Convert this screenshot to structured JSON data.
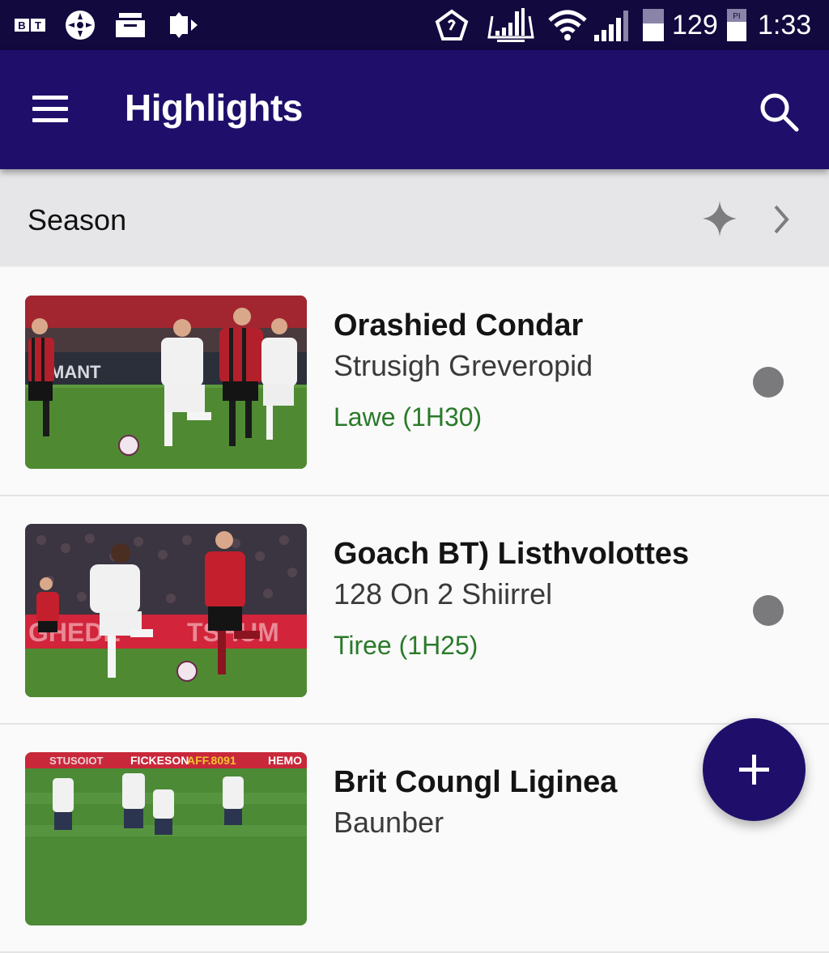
{
  "status_bar": {
    "left_icons": [
      "bt-sport-icon",
      "football-icon",
      "tray-icon",
      "cast-icon"
    ],
    "left_icon_text": "BT",
    "right_icons": [
      "pentagon-notification-icon",
      "chart-notification-icon",
      "wifi-icon",
      "signal-icon"
    ],
    "battery_value": "129",
    "battery_label": "PI",
    "time": "1:33"
  },
  "app_bar": {
    "title": "Highlights",
    "menu_icon": "hamburger-menu-icon",
    "search_icon": "search-icon",
    "color": "#1f0f6b"
  },
  "season_bar": {
    "label": "Season",
    "star_icon": "sparkle-icon",
    "chevron_icon": "chevron-right-icon"
  },
  "items": [
    {
      "title": "Orashied Condar",
      "subtitle": "Strusigh Greveropid",
      "meta": "Lawe (1H30)",
      "thumbnail": "football match: white kit vs red-black striped kit"
    },
    {
      "title": "Goach BT) Listhvolottes",
      "subtitle": "128 On 2 Shiirrel",
      "meta": "Tiree (1H25)",
      "thumbnail": "football match: white kit player vs red kit player"
    },
    {
      "title": "Brit Coungl Liginea",
      "subtitle": "Baunber",
      "meta": "",
      "thumbnail": "football players warming up on pitch",
      "banner_texts": [
        "STUSOIOT",
        "FICKESON",
        "AFF.8091",
        "HEMO"
      ]
    }
  ],
  "fab": {
    "icon": "plus-icon",
    "color": "#1f0f6b"
  },
  "colors": {
    "status_bar": "#12093f",
    "meta_green": "#2a7a2a",
    "season_bg": "#e6e6e8"
  }
}
